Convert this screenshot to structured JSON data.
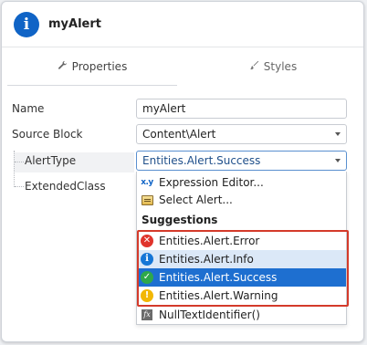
{
  "header": {
    "title": "myAlert",
    "icon": "info-circle-icon",
    "accent": "#1064c6"
  },
  "tabs": [
    {
      "label": "Properties",
      "icon": "wrench-icon",
      "active": true
    },
    {
      "label": "Styles",
      "icon": "brush-icon",
      "active": false
    }
  ],
  "properties": {
    "name": {
      "label": "Name",
      "value": "myAlert"
    },
    "source_block": {
      "label": "Source Block",
      "value": "Content\\Alert"
    },
    "alert_type": {
      "label": "AlertType",
      "value": "Entities.Alert.Success"
    },
    "extended_class": {
      "label": "ExtendedClass"
    }
  },
  "dropdown": {
    "actions": [
      {
        "label": "Expression Editor...",
        "icon": "expression-icon"
      },
      {
        "label": "Select Alert...",
        "icon": "select-icon"
      }
    ],
    "suggestions_header": "Suggestions",
    "suggestions": [
      {
        "label": "Entities.Alert.Error",
        "icon": "error-icon",
        "glyph": "✕",
        "state": "normal"
      },
      {
        "label": "Entities.Alert.Info",
        "icon": "info-icon",
        "glyph": "i",
        "state": "hover"
      },
      {
        "label": "Entities.Alert.Success",
        "icon": "success-icon",
        "glyph": "✓",
        "state": "selected"
      },
      {
        "label": "Entities.Alert.Warning",
        "icon": "warning-icon",
        "glyph": "!",
        "state": "normal"
      }
    ],
    "extra": {
      "label": "NullTextIdentifier()",
      "icon": "function-icon",
      "glyph": "fx"
    },
    "highlight_color": "#d43a2a",
    "selection_color": "#1e6fd0"
  }
}
